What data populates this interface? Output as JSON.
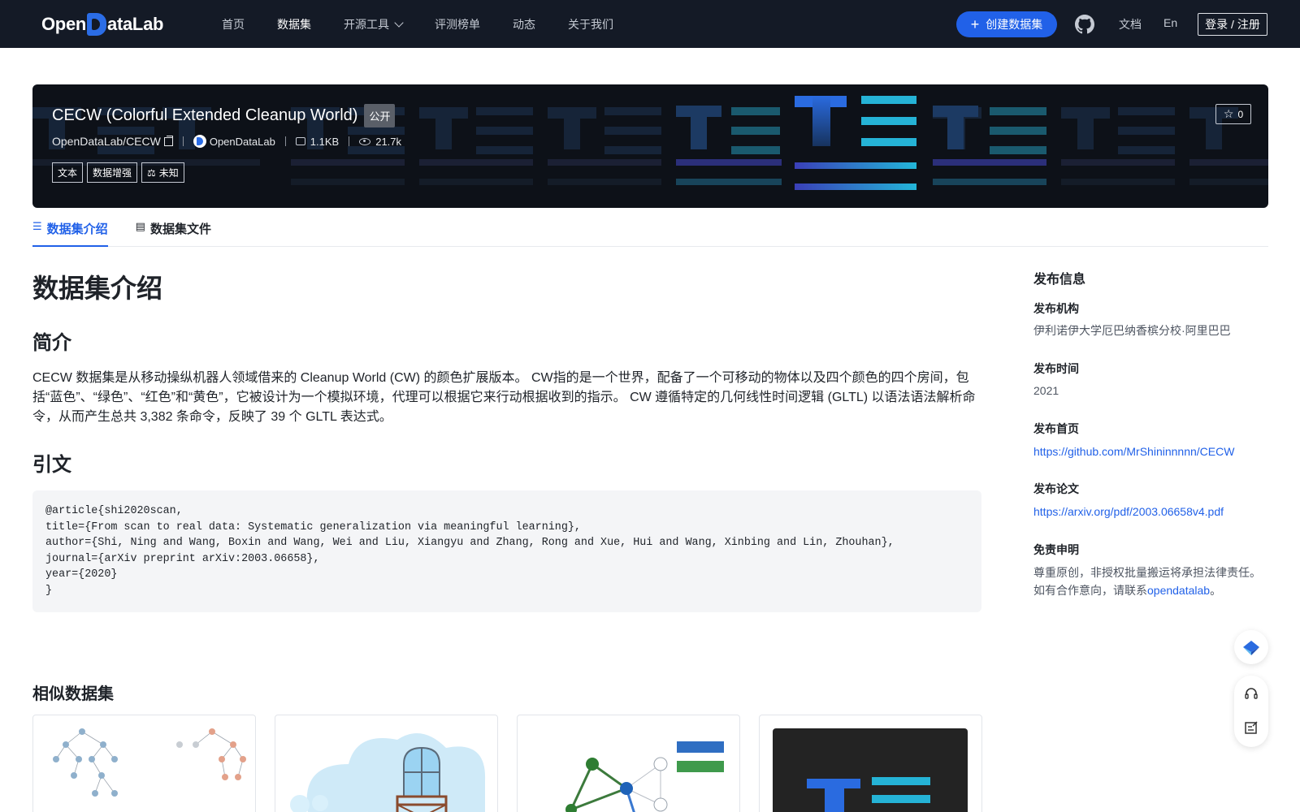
{
  "nav": {
    "logo_text_left": "Open",
    "logo_text_right": "ataLab",
    "items": [
      {
        "label": "首页",
        "active": false
      },
      {
        "label": "数据集",
        "active": true
      },
      {
        "label": "开源工具",
        "active": false,
        "has_dropdown": true
      },
      {
        "label": "评测榜单",
        "active": false
      },
      {
        "label": "动态",
        "active": false
      },
      {
        "label": "关于我们",
        "active": false
      }
    ],
    "create_label": "创建数据集",
    "github_icon": "github-icon",
    "docs_label": "文档",
    "lang_label": "En",
    "login_label": "登录 / 注册"
  },
  "hero": {
    "title": "CECW (Colorful Extended Cleanup World)",
    "visibility": "公开",
    "repo": "OpenDataLab/CECW",
    "org": "OpenDataLab",
    "size": "1.1KB",
    "views": "21.7k",
    "tags": [
      "文本",
      "数据增强"
    ],
    "license": "未知",
    "stars": "0"
  },
  "tabs": [
    {
      "label": "数据集介绍",
      "active": true,
      "icon": "database-icon"
    },
    {
      "label": "数据集文件",
      "active": false,
      "icon": "file-icon"
    }
  ],
  "main": {
    "title": "数据集介绍",
    "intro_heading": "简介",
    "intro_text": "CECW 数据集是从移动操纵机器人领域借来的 Cleanup World (CW) 的颜色扩展版本。 CW指的是一个世界，配备了一个可移动的物体以及四个颜色的四个房间，包括“蓝色”、“绿色”、“红色”和“黄色”，它被设计为一个模拟环境，代理可以根据它来行动根据收到的指示。 CW 遵循特定的几何线性时间逻辑 (GLTL) 以语法语法解析命令，从而产生总共 3,382 条命令，反映了 39 个 GLTL 表达式。",
    "citation_heading": "引文",
    "citation_code": "@article{shi2020scan,\ntitle={From scan to real data: Systematic generalization via meaningful learning},\nauthor={Shi, Ning and Wang, Boxin and Wang, Wei and Liu, Xiangyu and Zhang, Rong and Xue, Hui and Wang, Xinbing and Lin, Zhouhan},\njournal={arXiv preprint arXiv:2003.06658},\nyear={2020}\n}"
  },
  "sidebar": {
    "title": "发布信息",
    "org_label": "发布机构",
    "org_value": "伊利诺伊大学厄巴纳香槟分校·阿里巴巴",
    "time_label": "发布时间",
    "time_value": "2021",
    "home_label": "发布首页",
    "home_url": "https://github.com/MrShininnnnn/CECW",
    "paper_label": "发布论文",
    "paper_url": "https://arxiv.org/pdf/2003.06658v4.pdf",
    "disclaimer_label": "免责申明",
    "disclaimer_line1": "尊重原创，非授权批量搬运将承担法律责任。",
    "disclaimer_line2_prefix": "如有合作意向，请联系",
    "disclaimer_link": "opendatalab",
    "disclaimer_suffix": "。"
  },
  "similar": {
    "title": "相似数据集"
  },
  "colors": {
    "nav_bg": "#141a26",
    "accent": "#2161e8",
    "hero_bg": "#0d1118"
  }
}
